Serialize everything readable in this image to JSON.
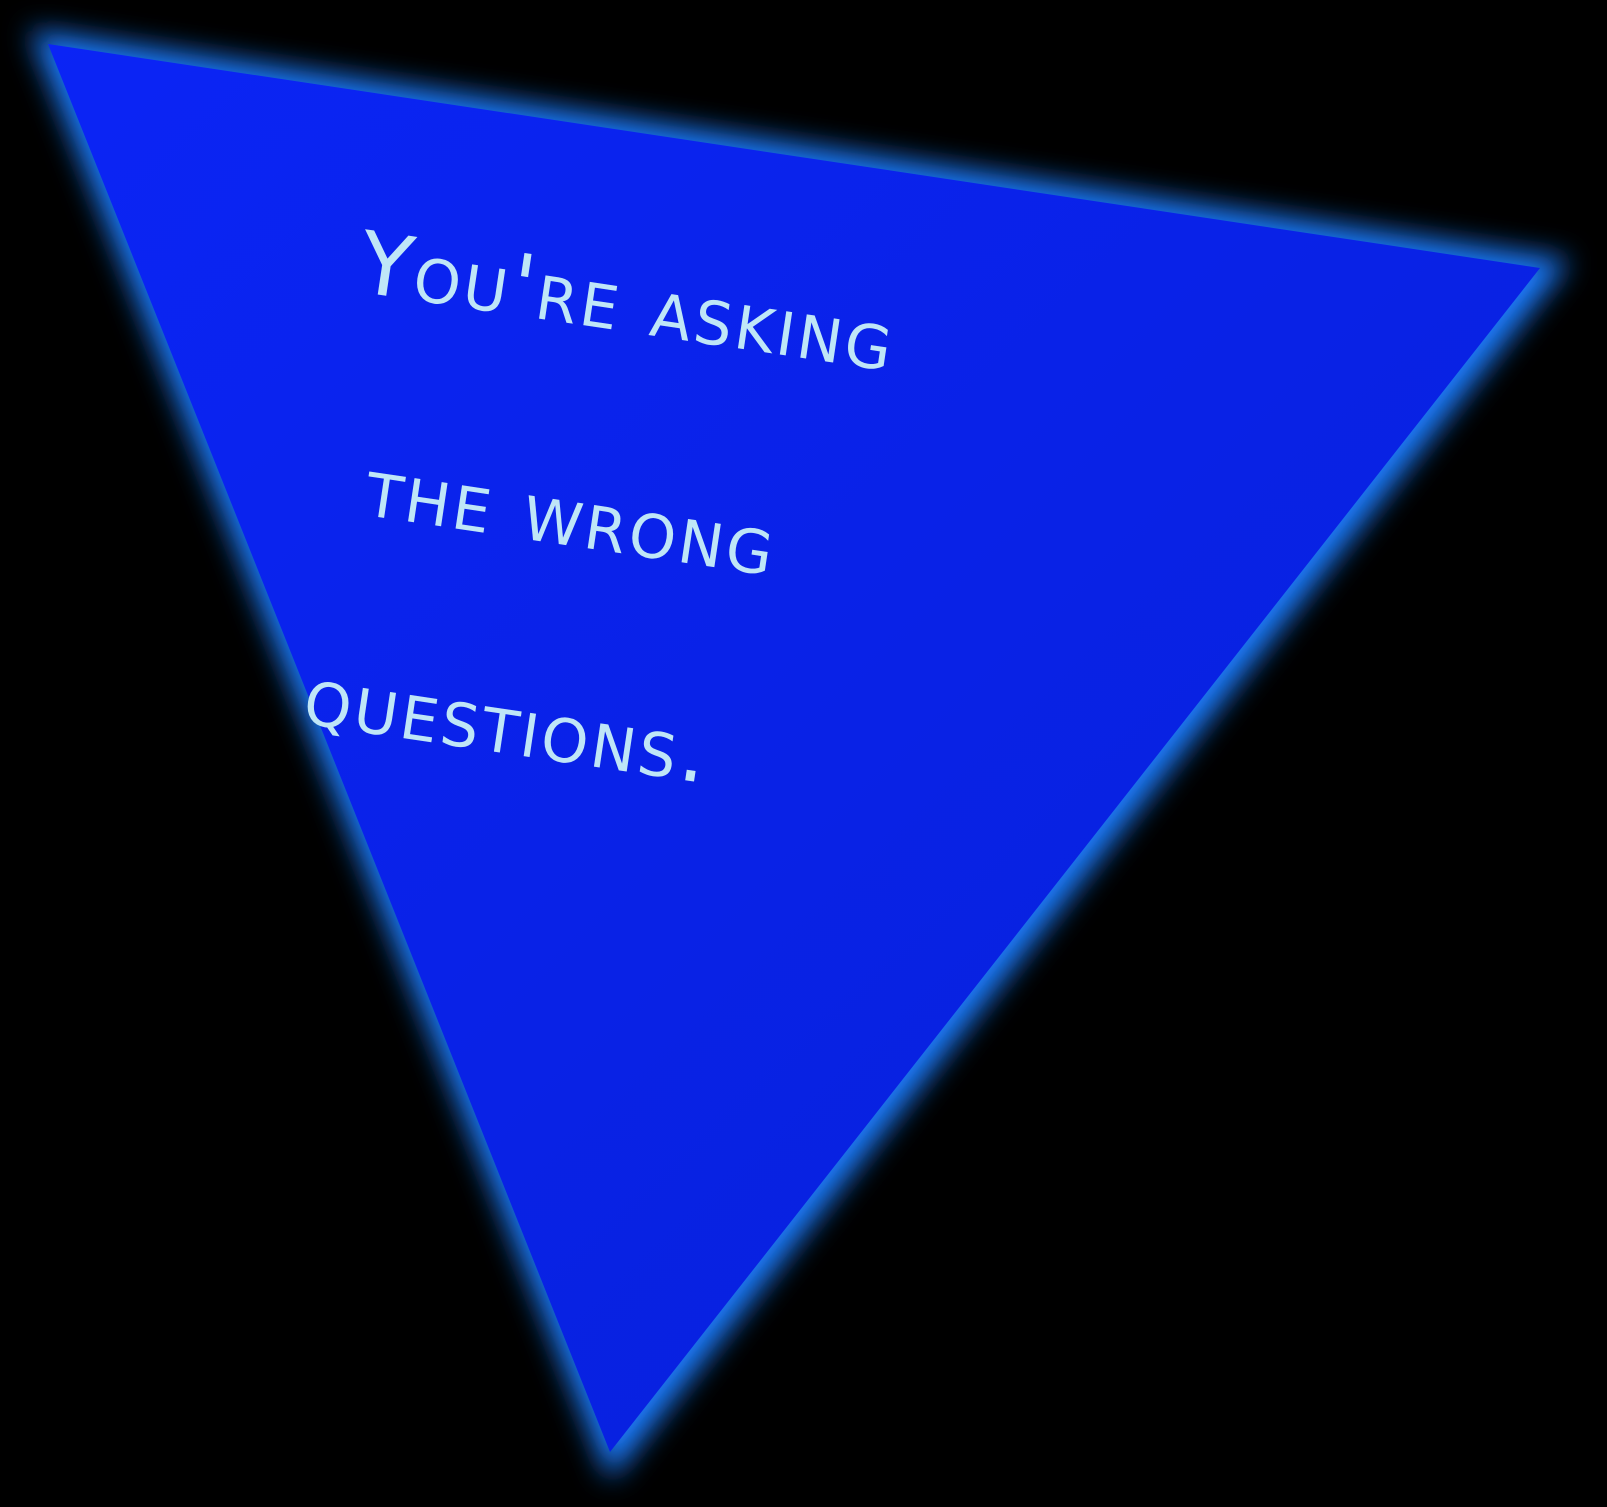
{
  "pennant": {
    "fill_color": "#0a1ef2",
    "edge_color": "#1a7dff",
    "text_color": "#bfe6f7"
  },
  "quote": {
    "line1": "You're asking",
    "line2": "the wrong",
    "line3": "questions."
  }
}
